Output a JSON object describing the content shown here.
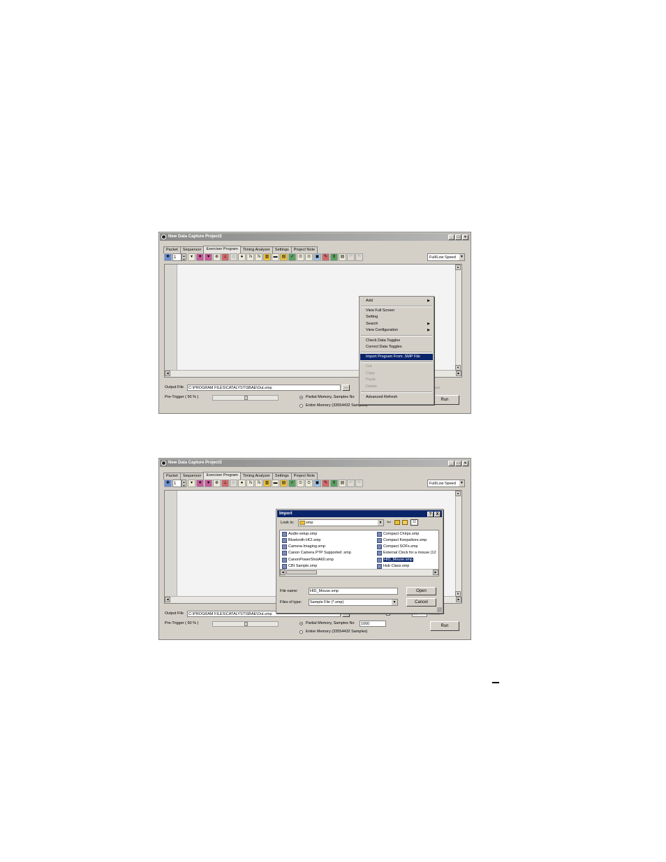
{
  "window1": {
    "title": "New Data Capture Project2",
    "tabs": [
      "Packet",
      "Sequencer",
      "Exerciser Program",
      "Timing Analyzer",
      "Settings",
      "Project Note"
    ],
    "spin_value": "1",
    "speed": "Full/Low Speed",
    "output_label": "Output File",
    "output_value": "C:\\PROGRAM FILES\\CATALYST\\SBAE\\Out.smp",
    "browse": "...",
    "pretrigger_label": "Pre-Trigger ( 50 % )",
    "partial_label": "Partial Memory, Samples No",
    "entire_label": "Entire Memory (33554432 Samples)",
    "times_label": "times",
    "run_label": "Run",
    "menu": {
      "add": "Add",
      "view_full_screen": "View Full Screen",
      "setting": "Setting",
      "search": "Search",
      "view_configuration": "View Configuration",
      "check_data_toggles": "Check Data Toggles",
      "correct_data_toggles": "Correct Data Toggles",
      "import_program": "Import Program From .SMP File",
      "cut": "Cut",
      "copy": "Copy",
      "paste": "Paste",
      "delete": "Delete",
      "advanced_refresh": "Advanced Refresh"
    }
  },
  "window2": {
    "title": "New Data Capture Project3",
    "tabs": [
      "Packet",
      "Sequencer",
      "Exerciser Program",
      "Timing Analyzer",
      "Settings",
      "Project Note"
    ],
    "spin_value": "1",
    "speed": "Full/Low Speed",
    "output_label": "Output File",
    "output_value": "C:\\PROGRAM FILES\\CATALYST\\SBAE\\Out.smp",
    "browse": "...",
    "auto_run_label": "Auto Run",
    "auto_run_value": "20",
    "times_label": "times",
    "pretrigger_label": "Pre-Trigger ( 50 % )",
    "partial_label": "Partial Memory, Samples No",
    "samples_value": "1000",
    "entire_label": "Entire Memory (33554432 Samples)",
    "run_label": "Run",
    "dialog": {
      "title": "Import",
      "help": "?",
      "close": "X",
      "look_in_label": "Look in:",
      "look_in_value": "smp",
      "files": [
        "Audio-setup.smp",
        "Bluetooth-HCI.smp",
        "Camera-Imaging.smp",
        "Canon Camera PTP Supported .smp",
        "CanonPowerShotA60.smp",
        "CBI Sample.smp",
        "Compact Chirps.smp",
        "Compact Keepalives.smp",
        "Compact SOFs.smp",
        "External Clock for a mouse (12",
        "HID_Mouse.smp",
        "Hub Class.smp"
      ],
      "selected_file": "HID_Mouse.smp",
      "file_name_label": "File name:",
      "file_name_value": "HID_Mouse.smp",
      "files_of_type_label": "Files of type:",
      "files_of_type_value": "Sample File (*.smp)",
      "open_label": "Open",
      "cancel_label": "Cancel"
    }
  },
  "icons": [
    "app-icon",
    "minimize-icon",
    "maximize-icon",
    "close-icon",
    "folder-icon",
    "back-icon",
    "up-folder-icon",
    "new-folder-icon",
    "view-menu-icon",
    "file-icon"
  ],
  "colors": {
    "menu_highlight": "#0a246a",
    "dialog_title": "#0a246a",
    "window_face": "#d4d0c8"
  }
}
